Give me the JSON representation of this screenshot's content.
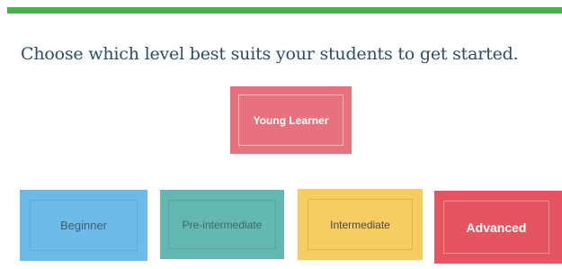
{
  "header": {
    "accent_color": "#46b04a"
  },
  "title": "Choose which level best suits your students to get started.",
  "levels": {
    "young_learner": {
      "label": "Young Learner",
      "color": "#e8717e"
    },
    "beginner": {
      "label": "Beginner",
      "color": "#6dbbe8"
    },
    "pre_intermediate": {
      "label": "Pre-intermediate",
      "color": "#63b8b2"
    },
    "intermediate": {
      "label": "Intermediate",
      "color": "#f7cd63"
    },
    "advanced": {
      "label": "Advanced",
      "color": "#e45560"
    }
  }
}
